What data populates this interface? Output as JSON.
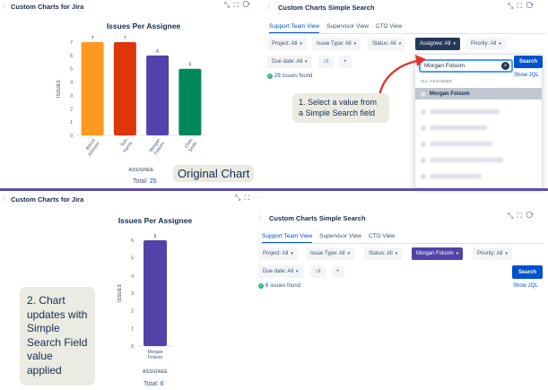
{
  "top": {
    "left_gadget": {
      "title": "Custom Charts for Jira",
      "controls": [
        "⤡",
        "⛶",
        "⟳"
      ],
      "chart_title": "Issues Per Assignee",
      "axis_title": "ISSUES",
      "x_axis_title": "ASSIGNEE",
      "total_label": "Total:",
      "total_value": "25"
    },
    "right_gadget": {
      "title": "Custom Charts Simple Search",
      "controls": [
        "⤡",
        "⛶",
        "⟳"
      ],
      "tabs": [
        "Support Team View",
        "Supervisor View",
        "CTO View"
      ],
      "filters": [
        "Project: All",
        "Issue Type: All",
        "Status: All",
        "Assignee: All",
        "Priority: All"
      ],
      "due_date": "Due date: All",
      "sort_icon": "↓≡",
      "add_icon": "+",
      "found_count": "29",
      "found_text": "issues found",
      "dropdown": {
        "input_value": "Morgan Folsom",
        "search_button": "Search",
        "section_header": "ALL ASSIGNEE",
        "selected_item": "Morgan Folsom",
        "show_jql": "Show JQL"
      }
    },
    "annotation": "1. Select a value from a Simple Search field",
    "original_label": "Original Chart"
  },
  "bottom": {
    "left_gadget": {
      "title": "Custom Charts for Jira",
      "controls": [
        "⤡",
        "⛶",
        "⋯"
      ],
      "chart_title": "Issues Per Assignee",
      "axis_title": "ISSUES",
      "x_axis_title": "ASSIGNEE",
      "total_label": "Total:",
      "total_value": "6"
    },
    "right_gadget": {
      "title": "Custom Charts Simple Search",
      "controls": [
        "⤡",
        "⛶",
        "⟳"
      ],
      "tabs": [
        "Support Team View",
        "Supervisor View",
        "CTO View"
      ],
      "filters": [
        "Project: All",
        "Issue Type: All",
        "Status: All",
        "Morgan Folsom",
        "Priority: All"
      ],
      "due_date": "Due date: All",
      "sort_icon": "↓≡",
      "add_icon": "+",
      "found_count": "6",
      "found_text": "issues found",
      "search_button": "Search",
      "show_jql": "Show JQL"
    },
    "annotation": "2. Chart updates with Simple Search Field value applied"
  },
  "colors": {
    "jira_blue": "#0052cc",
    "selected_filter": "#253858",
    "applied_filter": "#5243aa",
    "divider": "#5e4db2",
    "arrow": "#e5322d"
  },
  "chart_data": [
    {
      "type": "bar",
      "title": "Issues Per Assignee",
      "xlabel": "ASSIGNEE",
      "ylabel": "ISSUES",
      "categories": [
        "Becca Johnson",
        "Tom Harris",
        "Morgan Folsom",
        "Chris Smith"
      ],
      "values": [
        7,
        7,
        6,
        5
      ],
      "value_labels": [
        "7",
        "7",
        "6",
        "5"
      ],
      "colors": [
        "#ff991f",
        "#de350b",
        "#5243aa",
        "#00875a"
      ],
      "ylim": [
        0,
        7
      ],
      "yticks": [
        "0",
        "1",
        "2",
        "3",
        "4",
        "5",
        "6",
        "7"
      ],
      "grid": false,
      "legend": "none"
    },
    {
      "type": "bar",
      "title": "Issues Per Assignee",
      "xlabel": "ASSIGNEE",
      "ylabel": "ISSUES",
      "categories": [
        "Morgan Folsom"
      ],
      "values": [
        6
      ],
      "value_labels": [
        "6"
      ],
      "colors": [
        "#5243aa"
      ],
      "ylim": [
        0,
        6
      ],
      "yticks": [
        "0",
        "1",
        "2",
        "3",
        "4",
        "5",
        "6"
      ],
      "grid": false,
      "legend": "none"
    }
  ]
}
